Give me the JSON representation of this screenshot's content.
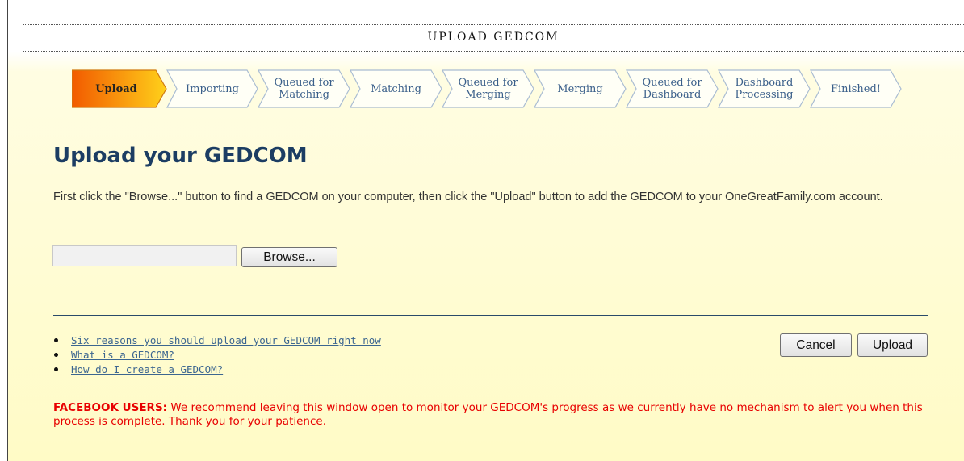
{
  "header": {
    "title": "UPLOAD GEDCOM"
  },
  "steps": [
    {
      "label": "Upload",
      "active": true
    },
    {
      "label": "Importing",
      "active": false
    },
    {
      "label": "Queued for Matching",
      "active": false
    },
    {
      "label": "Matching",
      "active": false
    },
    {
      "label": "Queued for Merging",
      "active": false
    },
    {
      "label": "Merging",
      "active": false
    },
    {
      "label": "Queued for Dashboard",
      "active": false
    },
    {
      "label": "Dashboard Processing",
      "active": false
    },
    {
      "label": "Finished!",
      "active": false
    }
  ],
  "main": {
    "title": "Upload your GEDCOM",
    "instructions": "First click the \"Browse...\" button to find a GEDCOM on your computer, then click the \"Upload\" button to add the GEDCOM to your OneGreatFamily.com account.",
    "file_input_value": "",
    "browse_label": "Browse..."
  },
  "links": [
    "Six reasons you should upload your GEDCOM right now",
    "What is a GEDCOM?",
    "How do I create a GEDCOM?"
  ],
  "actions": {
    "cancel_label": "Cancel",
    "upload_label": "Upload"
  },
  "notice": {
    "label": "FACEBOOK USERS:",
    "text": " We recommend leaving this window open to monitor your GEDCOM's progress as we currently have no mechanism to alert you when this process is complete. Thank you for your patience."
  },
  "colors": {
    "title": "#1c3d63",
    "step_text": "#3a5f8a",
    "step_active_start": "#f25a00",
    "step_active_end": "#ffd11a",
    "link": "#3c6690",
    "notice": "#e80000"
  }
}
